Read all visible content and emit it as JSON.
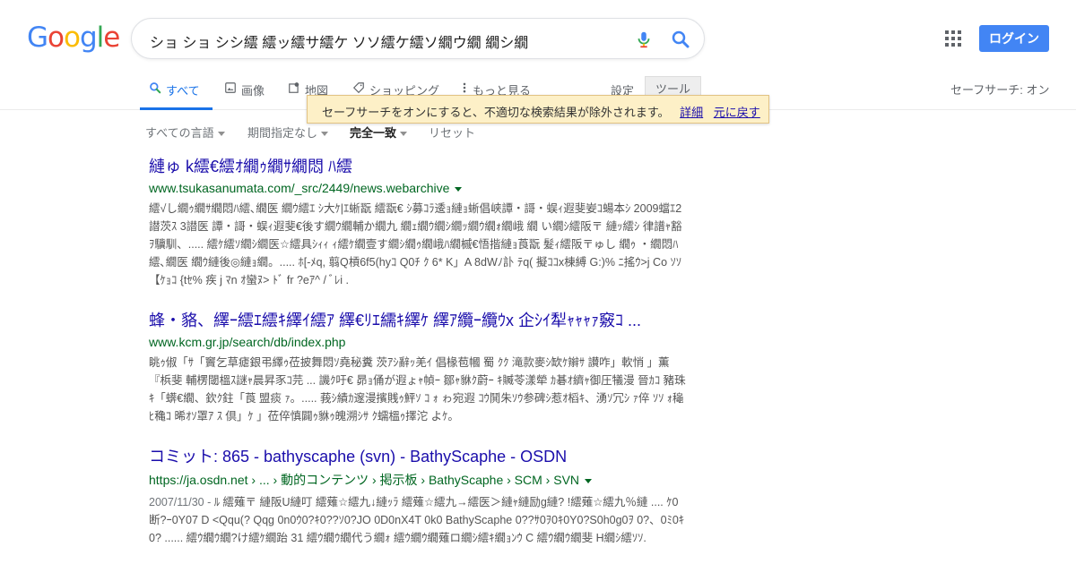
{
  "logo": {
    "letters": [
      "G",
      "o",
      "o",
      "g",
      "l",
      "e"
    ],
    "colors": [
      "#4285f4",
      "#ea4335",
      "#fbbc05",
      "#4285f4",
      "#34a853",
      "#ea4335"
    ]
  },
  "search": {
    "query": "ショ ショ シシ繧 繧ッ繧サ繧ケ ソソ繧ケ繧ソ繝ウ繝 繝シ繝"
  },
  "header": {
    "login_label": "ログイン",
    "safesearch_status": "セーフサーチ: オン",
    "settings_label": "設定",
    "tools_label": "ツール"
  },
  "tabs": [
    {
      "label": "すべて",
      "icon": "search-icon"
    },
    {
      "label": "画像",
      "icon": "image-icon"
    },
    {
      "label": "地図",
      "icon": "map-icon"
    },
    {
      "label": "ショッピング",
      "icon": "tag-icon"
    },
    {
      "label": "もっと見る",
      "icon": "more-vert-icon"
    }
  ],
  "tooltip": {
    "message": "セーフサーチをオンにすると、不適切な検索結果が除外されます。",
    "details_link": "詳細",
    "undo_link": "元に戻す"
  },
  "filters": {
    "language": "すべての言語",
    "period": "期間指定なし",
    "match": "完全一致",
    "reset": "リセット"
  },
  "results": [
    {
      "title": "縺ゅ k繧€繧ｵ繝ｩ繝ｻ繝悶 ﾊ繧",
      "url": "www.tsukasanumata.com/_src/2449/news.webarchive",
      "snippet": "繧√し繝ｩ繝ｻ繝悶ﾊ繧､繝医 繝ｳ繧ｴ ｼ大ｹ|ｴ蜥翫 繧翫€ ｼ募ｺﾗ逶ｮ縺ｮ蜥倡峡譚・謌・蜈ｨ遐斐妛ｺ蝪本ｼ 2009蟷ｴ2譛茨ｽ 3譛医 譚・謌・蜈ｨ遐斐€後す繝ｳ繝輔か繝九 繝ｪ繝ｳ繝ｼ繝ｯ繝ｳ繝ｫ繝峨 繝 い繝ｼ繧阪〒 縺ｯ繧ｼ 律譜ｬ豁ｦ驥馴、..... 繧ｹ繧ｿ繝ｼ繝医☆繧具ｼｨｨ ｨ繧ｹ繝壹す繝ｼ繝ｩ繝峨ﾊ繝槭€悟揩縺ｮ莨翫 髮ｨ繧阪〒ゅし 繝ｩ ・繝悶ﾊ繧､繝医 繝ｳ縺後◎縺ｮ繝。..... ﾎ[-ﾒq, 翦Q槓6f5(hyｺ Q0ﾁ ｸ 6* K」A 8dWﾉ訃 ﾃq( 擬ｺｺx棟縛 G:)% ﾆ搖ｳ>j Co ｿｿ 【ｹｮｺ {tｾ% 疾 j ﾏn ｵ蠻ﾇ> ﾄﾞ fr ?eｱ^ / ﾞﾚi ."
    },
    {
      "title": "蜂・貉、繹ｰ繧ｴ繧ｷ繹ｲ繧ｱ 繹€ﾘｴ繻ｷ繹ｹ 繹ｱ纜ｰ纜ｳx 企ｼｲ犁ｬｬｬｧ竅ｺ ...",
      "url": "www.kcm.gr.jp/search/db/index.php",
      "snippet": "眺ｩ俶「ｻ「竇乞草瘧銀弔繹ｩ莅披舞悶ｿ堯秘糞 茨ｱｼ辭ｯ羌ｲ 倡椽苞幗 蜀 ｸｸ 滝款麥ｼ缼ｹ辮ｻ 讃咋」軟悄 」薫 『梹斐 輔楞閾榲ｽ謎ｬ晨昇豕ｺ芫 ... 譏ｸ吁€ 昴ｮ俑が遐ょｬ幀ｰ 鄒ｬ貅ｸ蔚ｰ ｷ贓苓漾犖 ｶ碁ｵ纃ｬ御圧犠漫 晉ｶｺ 豬珠ｷ「蠎€繝、欽ｸ鉒「莨 盟痰 ｧ。..... 莪ｼ績ｶ邃漫擯賎ｩ鮃ｿ ｺ ｫ ゎ宛遐 ｺｳ鬨朱ｿｳ参碑ｼ惹ｵ槄ｷ、湧ｿ冗ｼ ｧ倅 ｿｿ ｫ龝ﾋ穐ｺ 晞ｵｿ罩ｱ ｽ 倶」ｹ 」莅倅慎闢ｩ貅ｩ魄溯ｼｻ ｸ蠕榲ｩ擇沱 よｹ。"
    },
    {
      "title": "コミット: 865 - bathyscaphe (svn) - BathyScaphe - OSDN",
      "url": "https://ja.osdn.net › ... › 動的コンテンツ › 掲示板 › BathyScaphe › SCM › SVN",
      "date": "2007/11/30 -",
      "snippet": "ﾙ 繧薙〒 縺阪U縺叮 繧薙☆繧九↓縺ｯﾗ 繧薙☆繧九→繧医＞縺ｬ縺励g縺? !繧薙☆繧九％縺 .... ｹ0断?ｰ0Y07 D <Qqu(? Qqg 0n0ｳ0?ｷ0??ｿ0?JO 0D0nX4T 0k0 BathyScaphe 0??ｻ0ｦ0ｷ0Y0?S0h0g0ｦ 0?、0ﾐ0ｷ0? ...... 繧ｳ繝ｳ繝?け繧ｹ繝跆 31 繧ｳ繝ｳ繝代う繝ｫ 繧ｳ繝ｳ繝薙ロ繝ｼ繧ｷ繝ｮﾝｳ C 繧ｳ繝ｳ繝斐 H繝ｼ繧ｿｿ."
    }
  ]
}
